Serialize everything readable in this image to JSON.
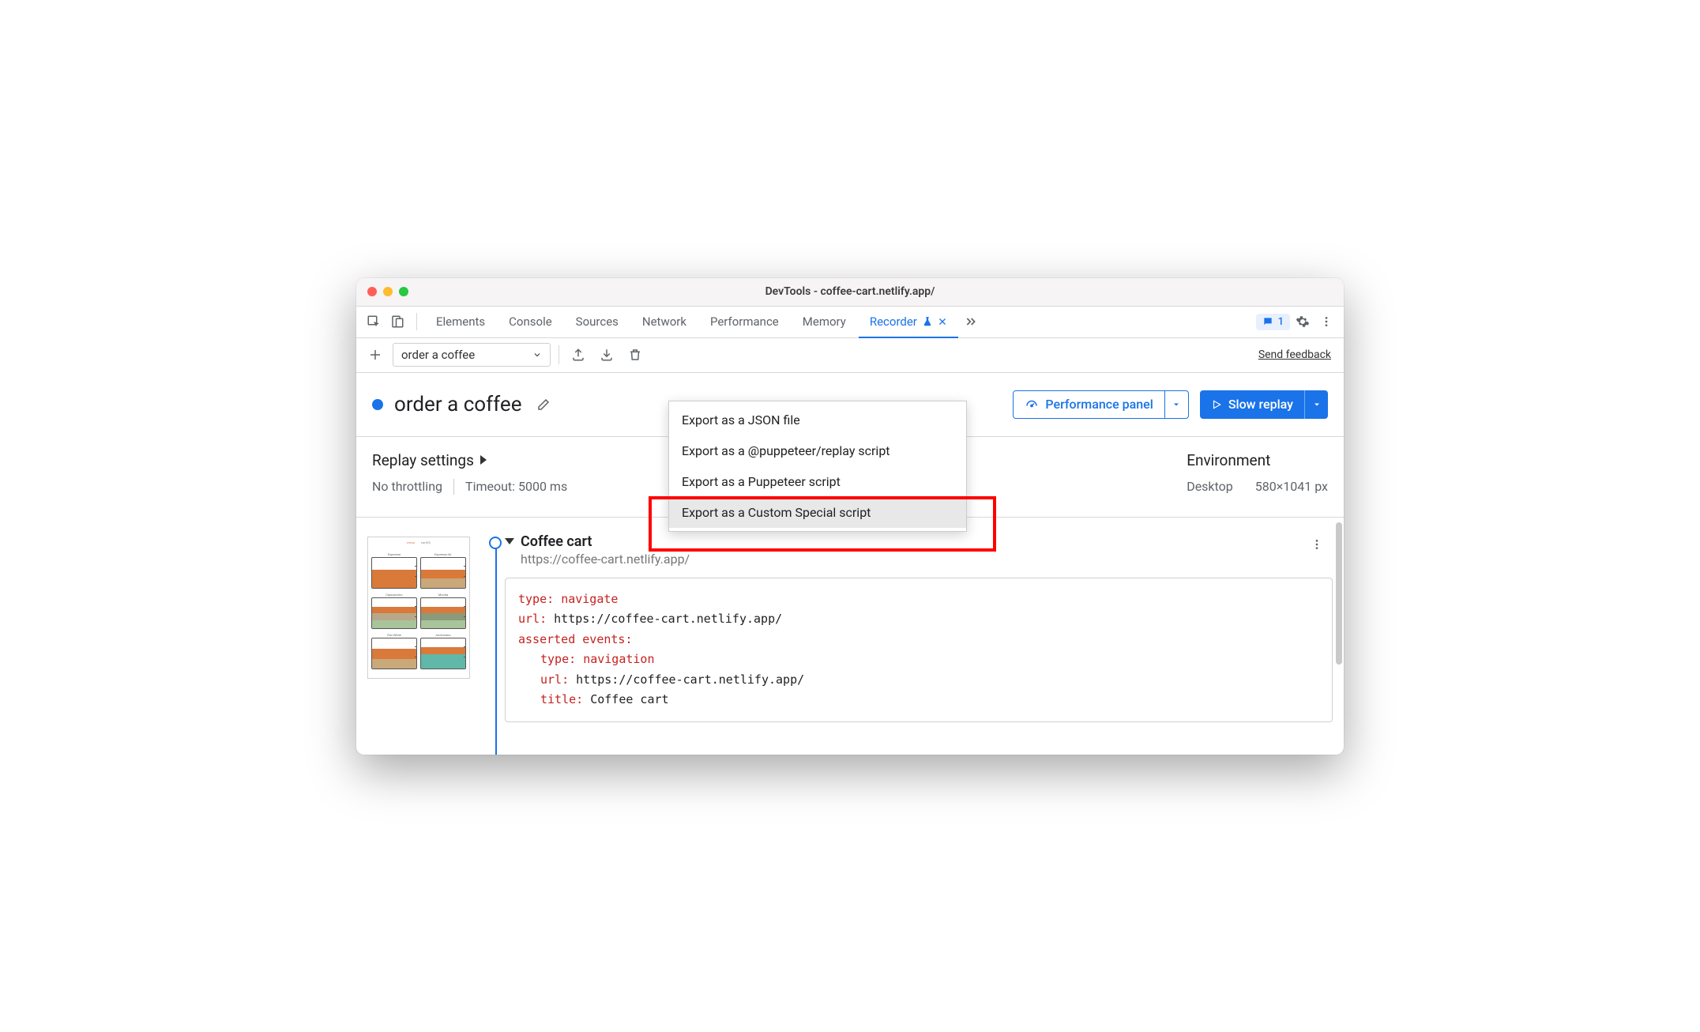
{
  "window": {
    "title": "DevTools - coffee-cart.netlify.app/"
  },
  "tabs": {
    "items": [
      "Elements",
      "Console",
      "Sources",
      "Network",
      "Performance",
      "Memory",
      "Recorder"
    ],
    "active": "Recorder",
    "issues_count": "1"
  },
  "toolbar": {
    "recording_name": "order a coffee",
    "feedback": "Send feedback"
  },
  "export_menu": {
    "items": [
      "Export as a JSON file",
      "Export as a @puppeteer/replay script",
      "Export as a Puppeteer script",
      "Export as a Custom Special script"
    ],
    "hovered_index": 3
  },
  "header": {
    "title": "order a coffee",
    "perf_button": "Performance panel",
    "replay_button": "Slow replay"
  },
  "settings": {
    "heading": "Replay settings",
    "throttling": "No throttling",
    "timeout": "Timeout: 5000 ms",
    "env_heading": "Environment",
    "env_device": "Desktop",
    "env_dims": "580×1041 px"
  },
  "step": {
    "title": "Coffee cart",
    "url": "https://coffee-cart.netlify.app/",
    "code": {
      "type_label": "type",
      "type_value": "navigate",
      "url_label": "url",
      "url_value": "https://coffee-cart.netlify.app/",
      "asserted_label": "asserted events",
      "nav_type_label": "type",
      "nav_type_value": "navigation",
      "nav_url_label": "url",
      "nav_url_value": "https://coffee-cart.netlify.app/",
      "nav_title_label": "title",
      "nav_title_value": "Coffee cart"
    }
  }
}
